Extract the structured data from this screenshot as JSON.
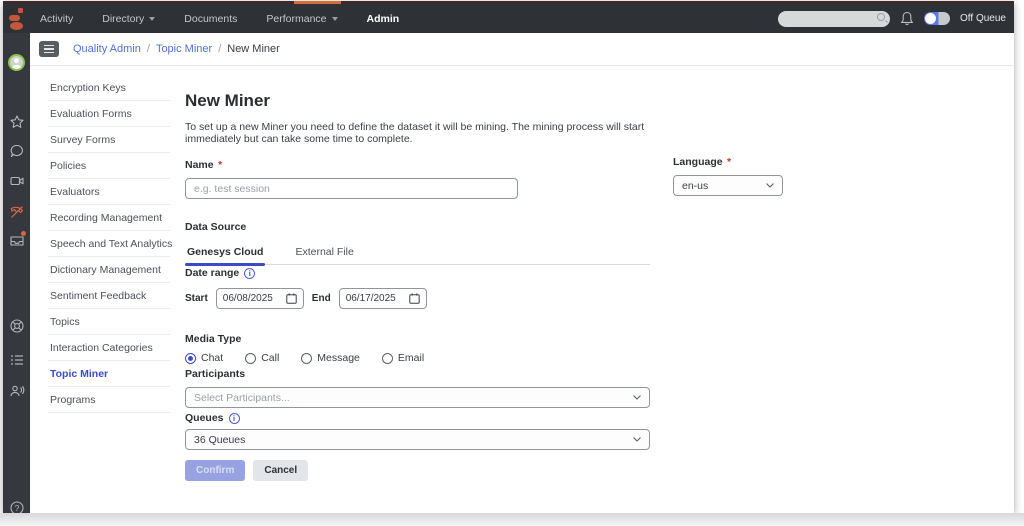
{
  "topbar": {
    "nav": [
      {
        "label": "Activity"
      },
      {
        "label": "Directory"
      },
      {
        "label": "Documents"
      },
      {
        "label": "Performance"
      },
      {
        "label": "Admin"
      }
    ],
    "off_queue_label": "Off Queue",
    "search_placeholder": ""
  },
  "rail_icons": [
    "user-avatar",
    "star",
    "chat",
    "video",
    "phone-disabled",
    "voicemail",
    "support-ring",
    "list",
    "agent-speaking",
    "help"
  ],
  "breadcrumb": {
    "links": [
      "Quality Admin",
      "Topic Miner"
    ],
    "separator": "/",
    "current": "New Miner"
  },
  "sidebar": {
    "items": [
      {
        "label": "Encryption Keys"
      },
      {
        "label": "Evaluation Forms"
      },
      {
        "label": "Survey Forms"
      },
      {
        "label": "Policies"
      },
      {
        "label": "Evaluators"
      },
      {
        "label": "Recording Management"
      },
      {
        "label": "Speech and Text Analytics"
      },
      {
        "label": "Dictionary Management"
      },
      {
        "label": "Sentiment Feedback"
      },
      {
        "label": "Topics"
      },
      {
        "label": "Interaction Categories"
      },
      {
        "label": "Topic Miner"
      },
      {
        "label": "Programs"
      }
    ],
    "active_item": "Topic Miner"
  },
  "form": {
    "title": "New Miner",
    "description": "To set up a new Miner you need to define the dataset it will be mining. The mining process will start immediately but can take some time to complete.",
    "name_field": {
      "label": "Name",
      "required_mark": "*",
      "placeholder": "e.g. test session",
      "value": ""
    },
    "language_field": {
      "label": "Language",
      "required_mark": "*",
      "value": "en-us"
    },
    "data_source": {
      "label": "Data Source",
      "tabs": [
        {
          "label": "Genesys Cloud"
        },
        {
          "label": "External File"
        }
      ],
      "active_tab": "Genesys Cloud"
    },
    "date_range": {
      "label": "Date range",
      "start_label": "Start",
      "start_value": "06/08/2025",
      "end_label": "End",
      "end_value": "06/17/2025"
    },
    "media_type": {
      "label": "Media Type",
      "options": [
        {
          "label": "Chat"
        },
        {
          "label": "Call"
        },
        {
          "label": "Message"
        },
        {
          "label": "Email"
        }
      ],
      "selected": "Chat"
    },
    "participants": {
      "label": "Participants",
      "placeholder": "Select Participants..."
    },
    "queues": {
      "label": "Queues",
      "value": "36 Queues"
    },
    "buttons": {
      "confirm": "Confirm",
      "cancel": "Cancel"
    }
  },
  "colors": {
    "topbar_bg": "#2e3236",
    "accent_orange": "#d96b38",
    "link_blue": "#4f71d8",
    "active_blue": "#3b4bc8",
    "avatar_ring_green": "#8cc541",
    "required_red": "#c0392b"
  }
}
